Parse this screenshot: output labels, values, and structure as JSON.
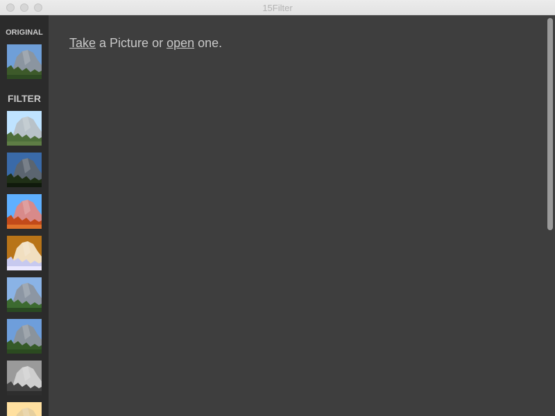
{
  "window": {
    "title": "15Filter",
    "controls": [
      "close",
      "minimize",
      "zoom"
    ]
  },
  "sidebar": {
    "original_label": "ORIGINAL",
    "filter_label": "FILTER",
    "original_thumb": {
      "name": "original",
      "sky": "#6f9fd8",
      "rock": "#8b95a0",
      "trees": "#3d5a2a",
      "ground": "#2e4a22"
    },
    "filters": [
      {
        "name": "filter-1",
        "sky": "#bfe3ff",
        "rock": "#b8c2c9",
        "trees": "#4d6e3a",
        "ground": "#5e7d45"
      },
      {
        "name": "filter-2",
        "sky": "#3a6aa8",
        "rock": "#5b6570",
        "trees": "#1f2f16",
        "ground": "#101a0c"
      },
      {
        "name": "filter-3",
        "sky": "#5fb0ff",
        "rock": "#d88a8a",
        "trees": "#c24a1a",
        "ground": "#e0722a"
      },
      {
        "name": "filter-4",
        "sky": "#b87418",
        "rock": "#f1dfc0",
        "trees": "#c7c9ef",
        "ground": "#eae8ff"
      },
      {
        "name": "filter-5",
        "sky": "#8ab3e6",
        "rock": "#8c96a3",
        "trees": "#3c6a30",
        "ground": "#2a4a22"
      },
      {
        "name": "filter-6",
        "sky": "#6e9edb",
        "rock": "#8a939c",
        "trees": "#355a28",
        "ground": "#2b4a20"
      },
      {
        "name": "filter-7",
        "sky": "#9a9a9a",
        "rock": "#cfcfcf",
        "trees": "#454545",
        "ground": "#2e2e2e"
      },
      {
        "name": "filter-8",
        "sky": "#ffe0a0",
        "rock": "#e6cf9e",
        "trees": "#8a7040",
        "ground": "#6b5530"
      }
    ]
  },
  "main": {
    "prompt_take_link": "Take",
    "prompt_middle": " a Picture or ",
    "prompt_open_link": "open",
    "prompt_end": " one."
  }
}
